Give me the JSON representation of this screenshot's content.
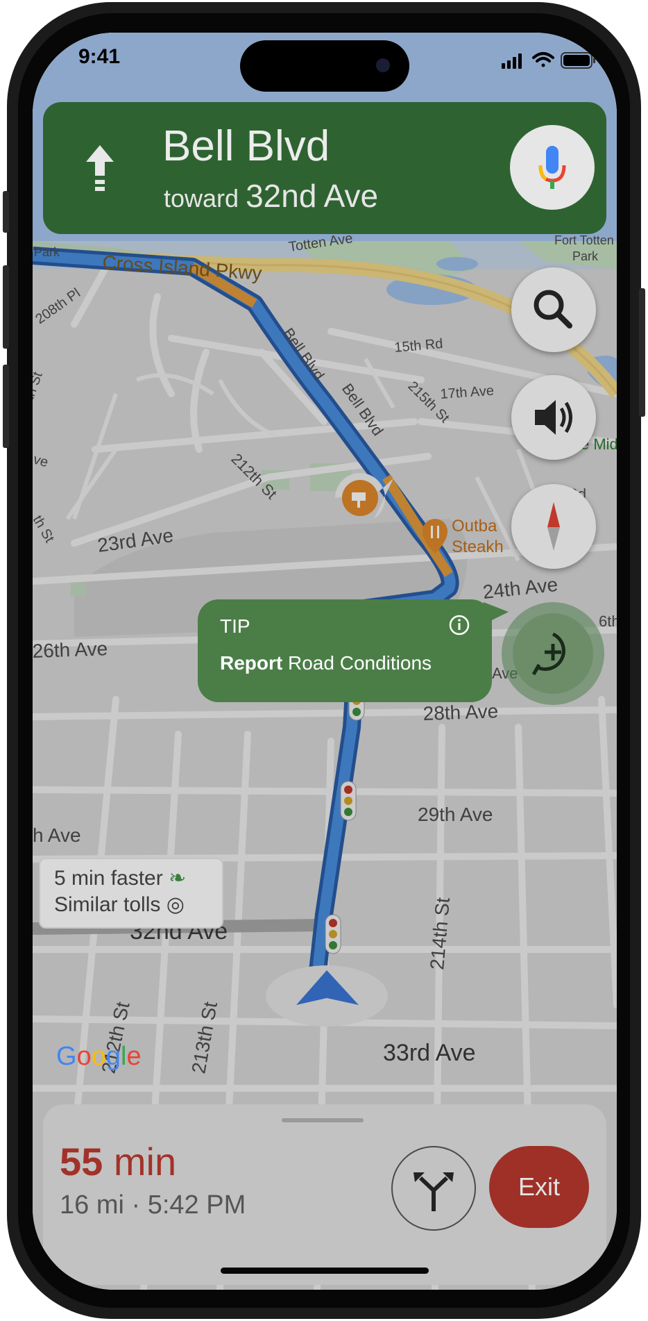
{
  "status_bar": {
    "time": "9:41"
  },
  "navigation": {
    "street": "Bell Blvd",
    "toward_prefix": "toward",
    "toward_street": "32nd Ave",
    "maneuver_icon": "arrow-straight-icon"
  },
  "map": {
    "labels": {
      "park": "Park",
      "totten_ave": "Totten Ave",
      "fort_totten_park_1": "Fort Totten",
      "fort_totten_park_2": "Park",
      "cross_island_pkwy": "Cross Island Pkwy",
      "208th_pl": "208th Pl",
      "bell_blvd_1": "Bell Blvd",
      "bell_blvd_2": "Bell Blvd",
      "15th_rd": "15th Rd",
      "215th_st": "215th St",
      "17th_ave": "17th Ave",
      "st_left": "th St",
      "ve_left": "ve",
      "th_st_left2": "th St",
      "212th_st": "212th St",
      "e_mid": "e Mid",
      "rd_right": "Rd",
      "23rd_ave": "23rd Ave",
      "outback_1": "Outba",
      "outback_2": "Steakh",
      "24th_ave": "24th Ave",
      "26th_ave": "26th Ave",
      "6th_right": "6th",
      "ave_mid": "Ave",
      "28th_ave": "28th Ave",
      "29th_ave": "29th Ave",
      "h_ave": "h Ave",
      "214th_st": "214th St",
      "32nd_ave": "32nd Ave",
      "212th_st_2": "212th St",
      "213th_st": "213th St",
      "33rd_ave": "33rd Ave"
    }
  },
  "tip": {
    "title": "TIP",
    "bold": "Report",
    "rest": " Road Conditions"
  },
  "route_callout": {
    "line1": "5 min faster",
    "line2": "Similar tolls"
  },
  "google_logo": [
    "G",
    "o",
    "o",
    "g",
    "l",
    "e"
  ],
  "trip": {
    "eta_value": "55",
    "eta_unit": "min",
    "distance": "16 mi",
    "separator": "·",
    "arrival": "5:42 PM"
  },
  "buttons": {
    "exit": "Exit"
  },
  "colors": {
    "nav_green": "#2e6331",
    "tip_green": "#4b7e47",
    "route_blue": "#3b82dc",
    "eta_red": "#a23229",
    "exit_red": "#9e3028"
  }
}
